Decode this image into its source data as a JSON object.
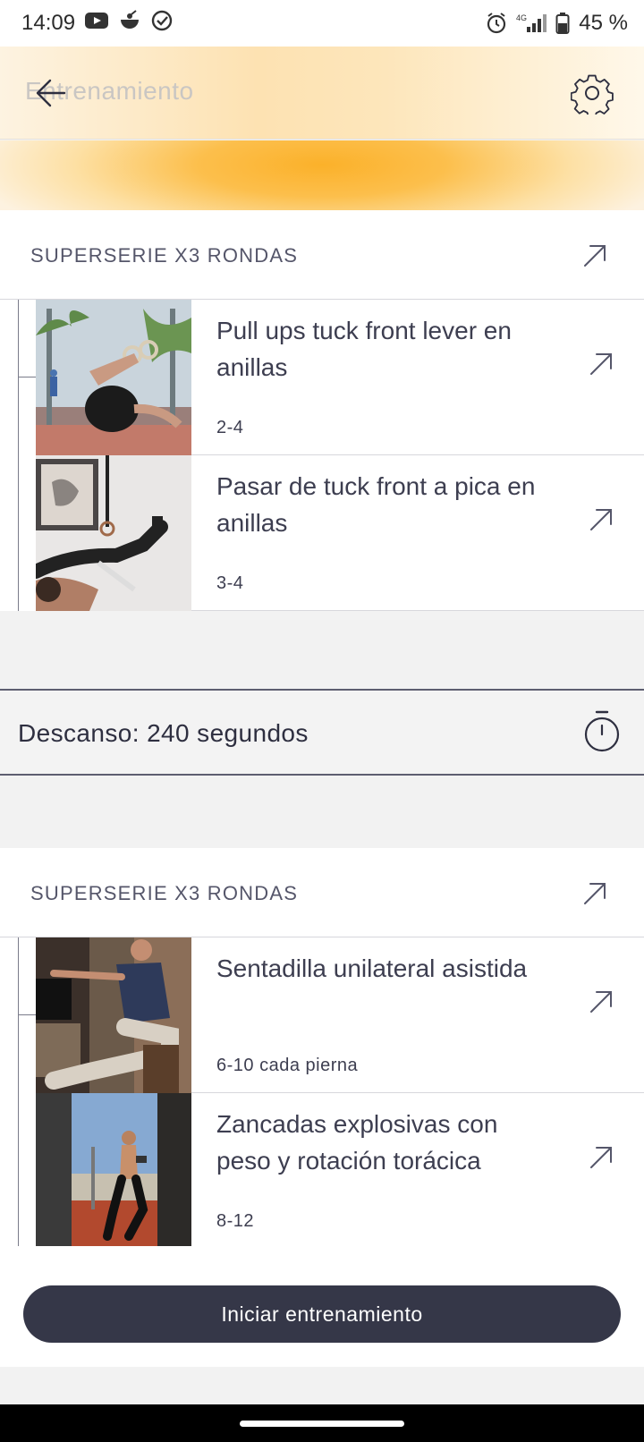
{
  "status_bar": {
    "time": "14:09",
    "battery": "45 %",
    "network": "4G",
    "icons_left": [
      "youtube-icon",
      "app-notification-icon",
      "check-circle-icon"
    ],
    "icons_right": [
      "alarm-icon",
      "signal-icon",
      "battery-icon"
    ]
  },
  "header": {
    "title": "Entrenamiento",
    "back_icon": "back-arrow-icon",
    "settings_icon": "gear-icon",
    "accent_color": "#fbb12a"
  },
  "blocks": [
    {
      "title": "SUPERSERIE X3 RONDAS",
      "exercises": [
        {
          "name": "Pull ups tuck front lever en anillas",
          "reps": "2-4"
        },
        {
          "name": "Pasar de tuck front a pica en anillas",
          "reps": "3-4"
        }
      ]
    },
    {
      "title": "SUPERSERIE X3 RONDAS",
      "exercises": [
        {
          "name": "Sentadilla unilateral asistida",
          "reps": "6-10 cada pierna"
        },
        {
          "name": "Zancadas explosivas con peso y rotación torácica",
          "reps": "8-12"
        }
      ]
    }
  ],
  "rest": {
    "label": "Descanso: 240 segundos"
  },
  "start_button": {
    "label": "Iniciar entrenamiento",
    "color": "#353748"
  }
}
